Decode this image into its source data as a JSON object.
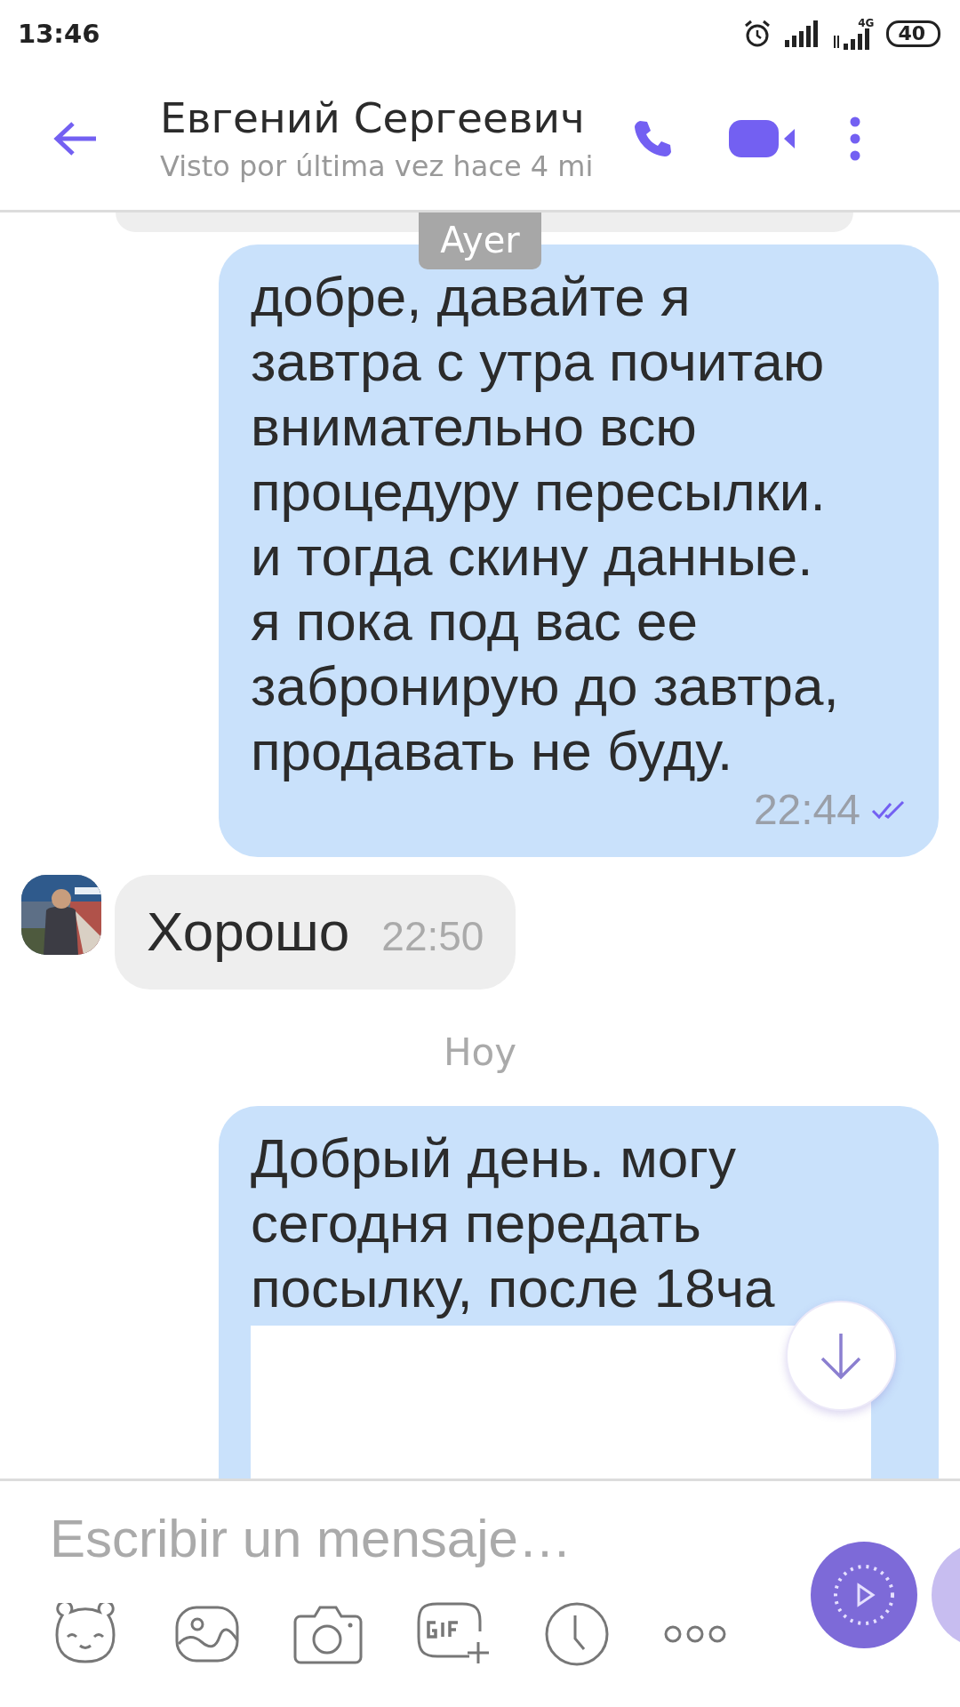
{
  "status_bar": {
    "time": "13:46",
    "network": "4G",
    "battery": "40"
  },
  "header": {
    "name": "Евгений Сергеевич",
    "last_seen": "Visto por última vez hace 4 mi"
  },
  "messages": [
    {
      "kind": "date",
      "text": "Ayer"
    },
    {
      "kind": "outgoing",
      "text": "добре, давайте я\nзавтра с утра почитаю\nвнимательно всю\nпроцедуру пересылки.\nи тогда скину данные.\nя пока под вас ее\nзабронирую до завтра,\nпродавать не буду.",
      "time": "22:44",
      "read": true
    },
    {
      "kind": "incoming",
      "text": "Хорошо",
      "time": "22:50"
    },
    {
      "kind": "date",
      "text": "Hoy"
    },
    {
      "kind": "outgoing",
      "text": "Добрый день. могу\nсегодня передать\nпосылку, после 18ча",
      "has_image": true
    }
  ],
  "composer": {
    "placeholder": "Escribir un mensaje…"
  }
}
